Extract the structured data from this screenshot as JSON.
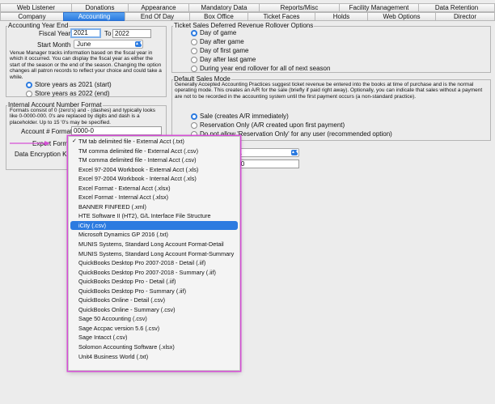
{
  "tabs_row1": [
    {
      "label": "Web Listener"
    },
    {
      "label": "Donations"
    },
    {
      "label": "Appearance"
    },
    {
      "label": "Mandatory Data"
    },
    {
      "label": "Reports/Misc"
    },
    {
      "label": "Facility Management"
    },
    {
      "label": "Data Retention"
    }
  ],
  "tabs_row2": [
    {
      "label": "Company"
    },
    {
      "label": "Accounting"
    },
    {
      "label": "End Of Day"
    },
    {
      "label": "Box Office"
    },
    {
      "label": "Ticket Faces"
    },
    {
      "label": "Holds"
    },
    {
      "label": "Web Options"
    },
    {
      "label": "Director"
    }
  ],
  "accounting_year": {
    "title": "Accounting Year End",
    "fiscal_year_label": "Fiscal Year",
    "fiscal_year_value": "2021",
    "to_label": "To",
    "to_value": "2022",
    "start_month_label": "Start Month",
    "start_month_value": "June",
    "description": "Venue Manager tracks information based on the fiscal year in which it occurred.  You can display the fiscal year as either the start of the season or the end of the season.  Changing the option changes all patron records to reflect your choice and could take a while.",
    "option_start": "Store years as 2021 (start)",
    "option_end": "Store years as 2022 (end)"
  },
  "internal_account": {
    "title": "Internal Account Number Format",
    "description": "Formats consist of 0 (zero's) and - (dashes) and typically looks like 0-0000-000.  0's are replaced by digits and dash is a placeholder.  Up to 15 '0's may be specified.",
    "account_label": "Account # Format",
    "account_value": "0000-0",
    "export_label": "Export Format",
    "encryption_label": "Data Encryption Ke"
  },
  "rollover": {
    "title": "Ticket Sales Deferred Revenue Rollover Options",
    "options": [
      {
        "label": "Day of game"
      },
      {
        "label": "Day after game"
      },
      {
        "label": "Day of first game"
      },
      {
        "label": "Day after last game"
      },
      {
        "label": "During year end rollover for all of next season"
      }
    ]
  },
  "sales_mode": {
    "title": "Default Sales Mode",
    "description": "Generally Accepted Accounting Practices suggest ticket revenue be entered into the books at time of purchase and is the normal operating mode.  This creates an A/R for the sale (briefly if paid right away).  Optionally, you can indicate that sales without a payment are not to be recorded in the accounting system until the first payment occurs (a non-standard practice).",
    "options": [
      {
        "label": "Sale (creates A/R immediately)"
      },
      {
        "label": "Reservation Only (A/R created upon first payment)"
      },
      {
        "label": "Do not allow 'Reservation Only' for any user (recommended option)"
      }
    ]
  },
  "partial_fields": {
    "right_select_text": "da",
    "right_input_text": "000"
  },
  "export_dropdown": {
    "items": [
      {
        "label": "TM tab delimited file - External Acct (.txt)"
      },
      {
        "label": "TM comma delimited file - External Acct (.csv)"
      },
      {
        "label": "TM comma delimited file - Internal Acct (.csv)"
      },
      {
        "label": "Excel 97-2004 Workbook - External Acct (.xls)"
      },
      {
        "label": "Excel 97-2004 Workbook - Internal Acct (.xls)"
      },
      {
        "label": "Excel Format - External Acct (.xlsx)"
      },
      {
        "label": "Excel Format - Internal Acct (.xlsx)"
      },
      {
        "label": "BANNER FINFEED (.xml)"
      },
      {
        "label": "HTE Software II (HT2), G/L Interface File Structure"
      },
      {
        "label": "iCity (.csv)"
      },
      {
        "label": "Microsoft Dynamics GP 2016 (.txt)"
      },
      {
        "label": "MUNIS Systems, Standard Long Account Format-Detail"
      },
      {
        "label": "MUNIS Systems, Standard Long Account Format-Summary"
      },
      {
        "label": "QuickBooks Desktop Pro 2007-2018 - Detail (.iif)"
      },
      {
        "label": "QuickBooks Desktop Pro 2007-2018 - Summary (.iif)"
      },
      {
        "label": "QuickBooks Desktop Pro - Detail (.iif)"
      },
      {
        "label": "QuickBooks Desktop Pro - Summary (.iif)"
      },
      {
        "label": "QuickBooks Online - Detail (.csv)"
      },
      {
        "label": "QuickBooks Online - Summary (.csv)"
      },
      {
        "label": "Sage 50 Accounting (.csv)"
      },
      {
        "label": "Sage Accpac version 5.6 (.csv)"
      },
      {
        "label": "Sage Intacct (.csv)"
      },
      {
        "label": "Solomon Accounting Software (.xlsx)"
      },
      {
        "label": "Unit4 Business World (.txt)"
      }
    ],
    "checked_symbol": "✓"
  },
  "colors": {
    "accent": "#2c7be0",
    "annotation": "#d64fd6"
  }
}
